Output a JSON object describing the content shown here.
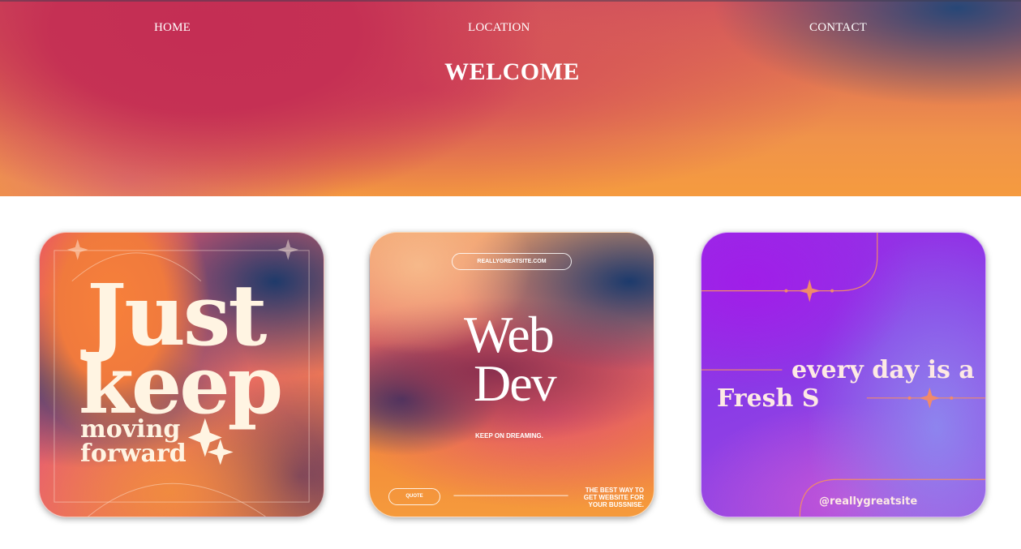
{
  "nav": {
    "home": "HOME",
    "location": "LOCATION",
    "contact": "CONTACT"
  },
  "hero": {
    "title": "WELCOME"
  },
  "cards": [
    {
      "big_line1": "Just",
      "big_line2": "keep",
      "small_line1": "moving",
      "small_line2": "forward"
    },
    {
      "url": "REALLYGREATSITE.COM",
      "title_line1": "Web",
      "title_line2": "Dev",
      "tagline": "KEEP ON DREAMING.",
      "button": "QUOTE",
      "note_line1": "THE BEST WAY TO",
      "note_line2": "GET WEBSITE FOR",
      "note_line3": "YOUR BUSSNISE."
    },
    {
      "line1": "every day is a",
      "line2": "Fresh S",
      "handle": "@reallygreatsite"
    }
  ]
}
